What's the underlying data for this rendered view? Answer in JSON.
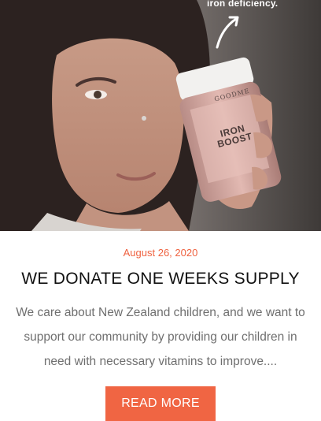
{
  "post": {
    "image_caption": "iron deficiency.",
    "jar_brand": "GOODME",
    "jar_title": "IRON BOOST",
    "date": "August 26, 2020",
    "title": "WE DONATE ONE WEEKS SUPPLY",
    "excerpt": "We care about New Zealand children, and we want to support our community by providing our children in need with necessary vitamins to improve....",
    "read_more_label": "READ MORE"
  },
  "colors": {
    "accent": "#f06543",
    "date": "#ef6240",
    "title": "#111111",
    "body_text": "#6f6f6f"
  }
}
